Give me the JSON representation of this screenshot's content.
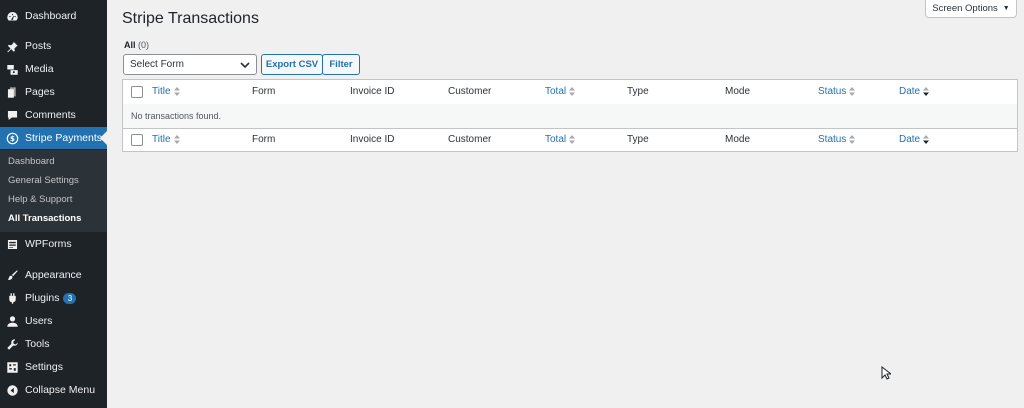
{
  "sidebar": {
    "items": [
      {
        "label": "Dashboard",
        "icon": "dashboard-icon"
      },
      {
        "label": "Posts",
        "icon": "pin-icon"
      },
      {
        "label": "Media",
        "icon": "media-icon"
      },
      {
        "label": "Pages",
        "icon": "pages-icon"
      },
      {
        "label": "Comments",
        "icon": "comment-icon"
      },
      {
        "label": "Stripe Payments",
        "icon": "dollar-icon",
        "current": true
      },
      {
        "label": "WPForms",
        "icon": "forms-icon"
      },
      {
        "label": "Appearance",
        "icon": "brush-icon"
      },
      {
        "label": "Plugins",
        "icon": "plugin-icon",
        "badge": "3"
      },
      {
        "label": "Users",
        "icon": "user-icon"
      },
      {
        "label": "Tools",
        "icon": "wrench-icon"
      },
      {
        "label": "Settings",
        "icon": "settings-icon"
      },
      {
        "label": "Collapse Menu",
        "icon": "collapse-icon"
      }
    ],
    "submenu": [
      "Dashboard",
      "General Settings",
      "Help & Support",
      "All Transactions"
    ],
    "active_submenu": "All Transactions"
  },
  "header": {
    "screen_options": "Screen Options",
    "title": "Stripe Transactions"
  },
  "views": {
    "all_label": "All",
    "all_count": "(0)"
  },
  "filters": {
    "select_value": "Select Form",
    "export_label": "Export CSV",
    "filter_label": "Filter"
  },
  "table": {
    "columns": {
      "title": "Title",
      "form": "Form",
      "invoice": "Invoice ID",
      "customer": "Customer",
      "total": "Total",
      "type": "Type",
      "mode": "Mode",
      "status": "Status",
      "date": "Date"
    },
    "empty_message": "No transactions found."
  },
  "colors": {
    "sidebar_bg": "#1d2327",
    "accent": "#2271b1",
    "page_bg": "#f0f0f1"
  }
}
